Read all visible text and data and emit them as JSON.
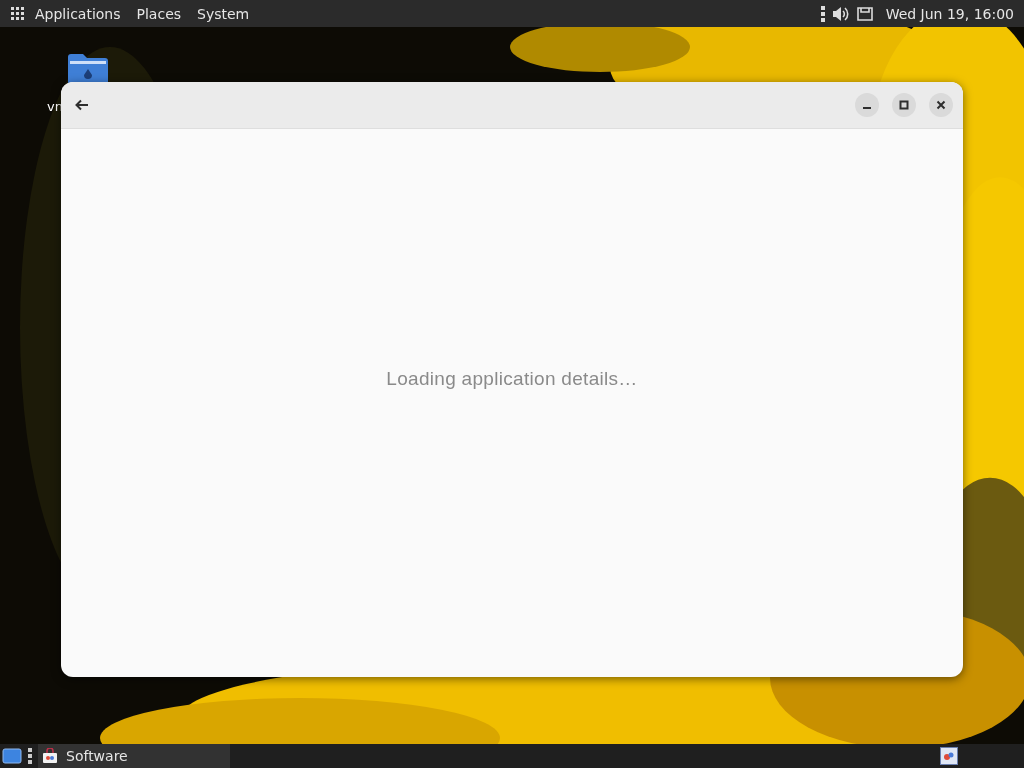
{
  "top_panel": {
    "menus": [
      "Applications",
      "Places",
      "System"
    ],
    "clock": "Wed Jun 19, 16:00"
  },
  "desktop": {
    "icons": [
      {
        "label": "vn"
      }
    ]
  },
  "window": {
    "message": "Loading application details…"
  },
  "taskbar": {
    "tasks": [
      {
        "label": "Software",
        "selected": true
      }
    ]
  }
}
